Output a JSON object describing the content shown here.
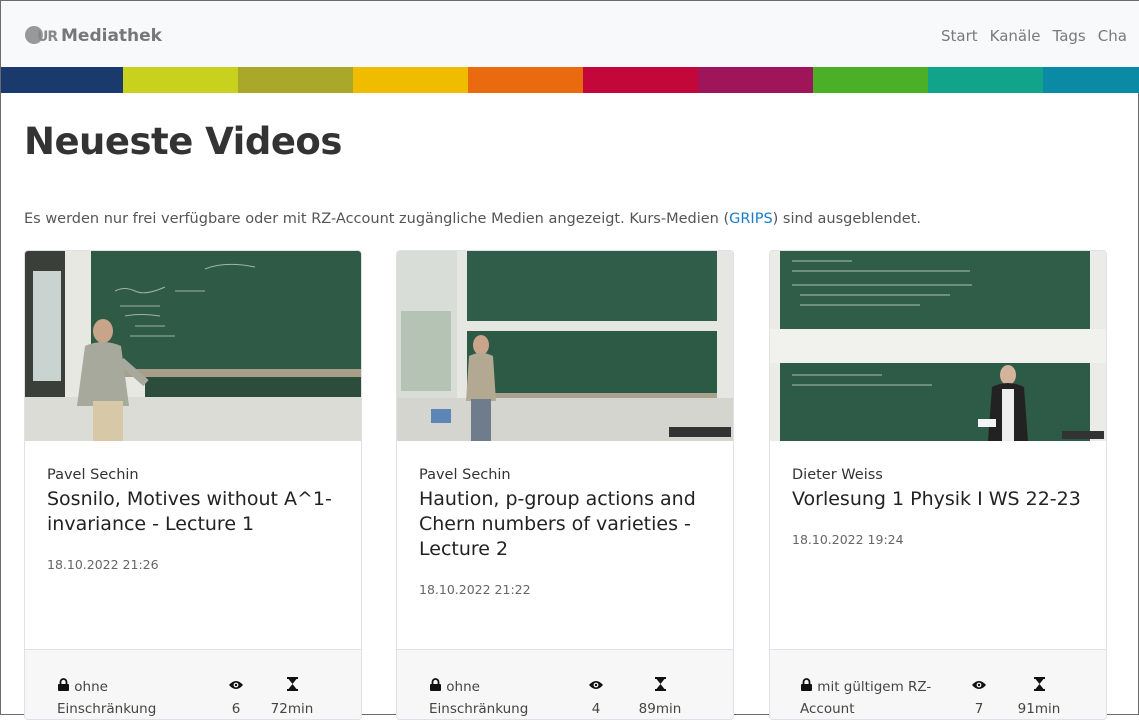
{
  "brand": {
    "logo_text": "UR",
    "name": "Mediathek"
  },
  "nav": {
    "items": [
      "Start",
      "Kanäle",
      "Tags",
      "Cha"
    ]
  },
  "colorbar": [
    "#1a3a6e",
    "#c8d21e",
    "#aaa82a",
    "#f0bc00",
    "#ea6a10",
    "#c4073a",
    "#a0145a",
    "#4caf28",
    "#12a48b",
    "#0b8aa6"
  ],
  "page": {
    "title": "Neueste Videos",
    "notice_before": "Es werden nur frei verfügbare oder mit RZ-Account zugängliche Medien angezeigt. Kurs-Medien (",
    "notice_link": "GRIPS",
    "notice_after": ") sind ausgeblendet."
  },
  "cards": [
    {
      "author": "Pavel Sechin",
      "title": "Sosnilo, Motives without A^1-invariance - Lecture 1",
      "date": "18.10.2022 21:26",
      "access_line1": "ohne",
      "access_line2": "Einschränkung",
      "views": "6",
      "duration": "72min"
    },
    {
      "author": "Pavel Sechin",
      "title": "Haution, p-group actions and Chern numbers of varieties - Lecture 2",
      "date": "18.10.2022 21:22",
      "access_line1": "ohne",
      "access_line2": "Einschränkung",
      "views": "4",
      "duration": "89min"
    },
    {
      "author": "Dieter Weiss",
      "title": "Vorlesung 1 Physik I WS 22-23",
      "date": "18.10.2022 19:24",
      "access_line1": "mit gültigem RZ-",
      "access_line2": "Account",
      "views": "7",
      "duration": "91min"
    }
  ],
  "icons": {
    "lock": "lock-icon",
    "eye": "eye-icon",
    "hourglass": "hourglass-icon"
  }
}
